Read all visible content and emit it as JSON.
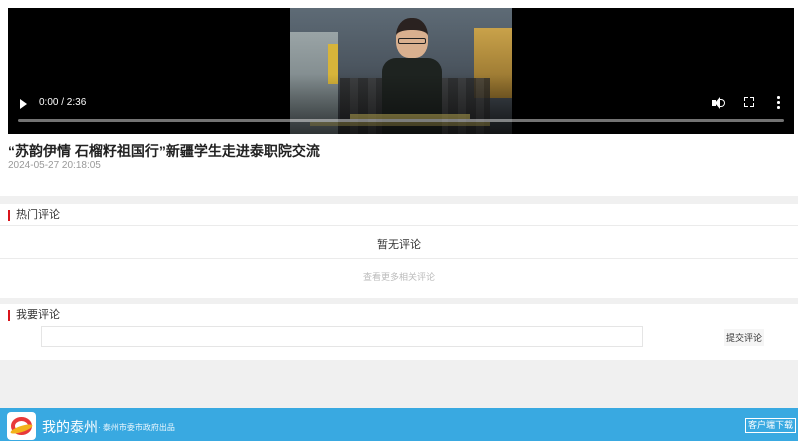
{
  "video": {
    "time_display": "0:00 / 2:36",
    "progress": 0.0,
    "play_icon": "play-icon",
    "volume_icon": "volume-icon",
    "fullscreen_icon": "fullscreen-icon",
    "more_icon": "more-options-icon"
  },
  "article": {
    "title": "“苏韵伊情 石榴籽祖国行”新疆学生走进泰职院交流",
    "date": "2024-05-27 20:18:05"
  },
  "hot_comments": {
    "heading": "热门评论",
    "empty_text": "暂无评论",
    "more_link": "查看更多相关评论"
  },
  "my_comment": {
    "heading": "我要评论",
    "input_value": "",
    "submit_label": "提交评论"
  },
  "footer": {
    "app_name": "我的泰州",
    "app_sub": "· 泰州市委市政府出品",
    "download_label": "客户端下载",
    "logo_icon": "app-logo-icon"
  },
  "colors": {
    "accent_red": "#d9141b",
    "footer_blue": "#39a9e1"
  }
}
